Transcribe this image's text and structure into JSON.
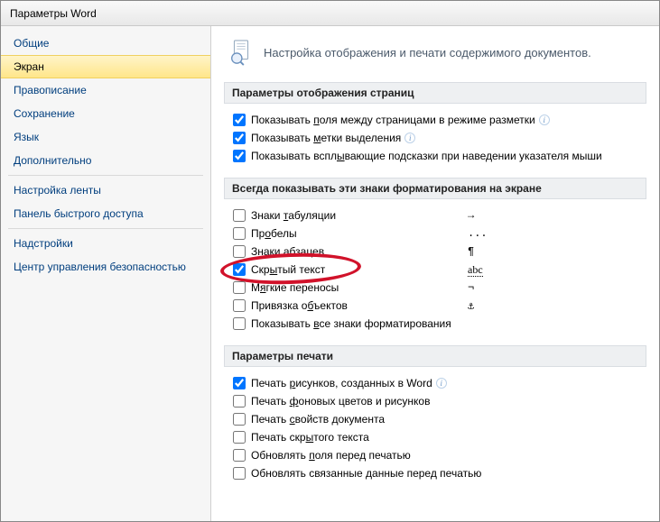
{
  "window": {
    "title": "Параметры Word"
  },
  "sidebar": {
    "items": [
      {
        "label": "Общие"
      },
      {
        "label": "Экран",
        "selected": true
      },
      {
        "label": "Правописание"
      },
      {
        "label": "Сохранение"
      },
      {
        "label": "Язык"
      },
      {
        "label": "Дополнительно"
      },
      {
        "label": "Настройка ленты",
        "sepBefore": true
      },
      {
        "label": "Панель быстрого доступа"
      },
      {
        "label": "Надстройки",
        "sepBefore": true
      },
      {
        "label": "Центр управления безопасностью"
      }
    ]
  },
  "header": {
    "desc": "Настройка отображения и печати содержимого документов."
  },
  "sec_display": {
    "title": "Параметры отображения страниц",
    "items": [
      {
        "pre": "Показывать ",
        "u": "п",
        "post": "оля между страницами в режиме разметки",
        "checked": true,
        "info": true
      },
      {
        "pre": "Показывать ",
        "u": "м",
        "post": "етки выделения",
        "checked": true,
        "info": true
      },
      {
        "pre": "Показывать вспл",
        "u": "ы",
        "post": "вающие подсказки при наведении указателя мыши",
        "checked": true
      }
    ]
  },
  "sec_marks": {
    "title": "Всегда показывать эти знаки форматирования на экране",
    "items": [
      {
        "pre": "Знаки ",
        "u": "т",
        "post": "абуляции",
        "mark": "→"
      },
      {
        "pre": "Пр",
        "u": "о",
        "post": "белы",
        "mark": "..."
      },
      {
        "pre": "Знаки ",
        "u": "а",
        "post": "бзацев",
        "mark": "¶"
      },
      {
        "pre": "Скр",
        "u": "ы",
        "post": "тый текст",
        "checked": true,
        "mark": "abc",
        "highlight": true
      },
      {
        "pre": "М",
        "u": "я",
        "post": "гкие переносы",
        "mark": "¬"
      },
      {
        "pre": "Привязка о",
        "u": "б",
        "post": "ъектов",
        "mark": "⚓"
      },
      {
        "pre": "Показывать ",
        "u": "в",
        "post": "се знаки форматирования"
      }
    ]
  },
  "sec_print": {
    "title": "Параметры печати",
    "items": [
      {
        "pre": "Печать ",
        "u": "р",
        "post": "исунков, созданных в Word",
        "checked": true,
        "info": true
      },
      {
        "pre": "Печать ",
        "u": "ф",
        "post": "оновых цветов и рисунков"
      },
      {
        "pre": "Печать ",
        "u": "с",
        "post": "войств документа"
      },
      {
        "pre": "Печать скр",
        "u": "ы",
        "post": "того текста"
      },
      {
        "pre": "Обновлять ",
        "u": "п",
        "post": "оля перед печатью"
      },
      {
        "pre": "Обновлять связанные ",
        "u": "д",
        "post": "анные перед печатью"
      }
    ]
  }
}
